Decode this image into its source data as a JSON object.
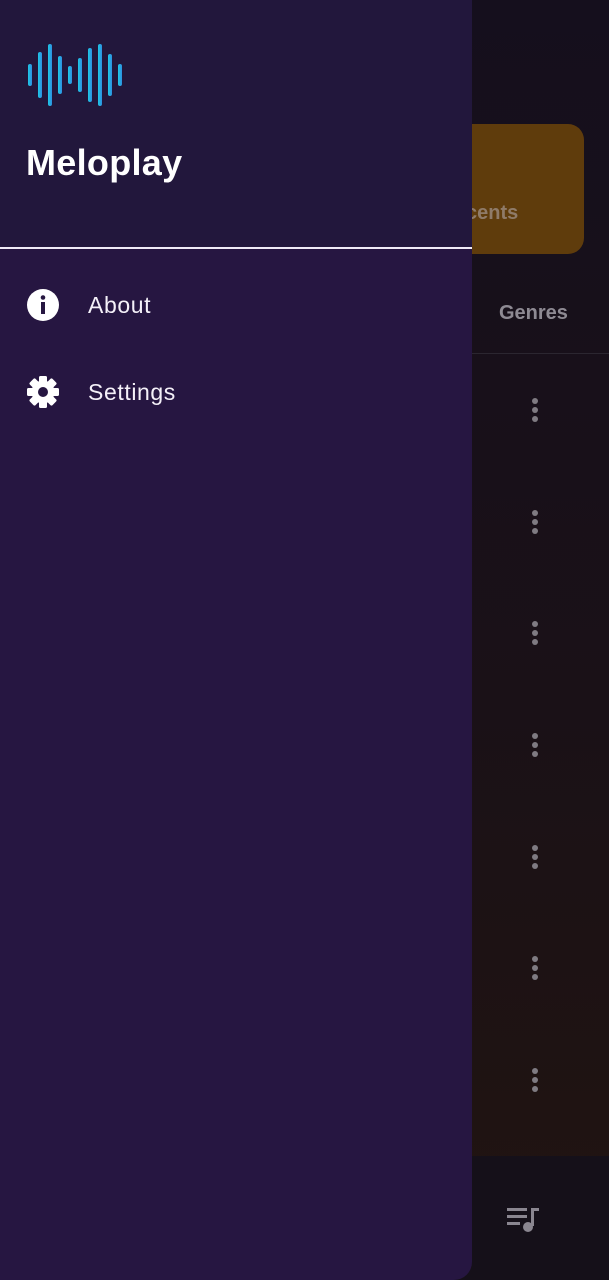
{
  "app": {
    "name": "Meloplay",
    "logo_icon": "soundwave-icon",
    "logo_gradient": [
      "#1ec8e6",
      "#2f8fe0"
    ]
  },
  "drawer": {
    "items": [
      {
        "label": "About",
        "icon": "info-icon"
      },
      {
        "label": "Settings",
        "icon": "gear-icon"
      }
    ]
  },
  "background": {
    "card_partial_text": "cents",
    "tab_partial_label": "Genres",
    "row_menu_icon": "more-vert-icon",
    "bottom_icon": "queue-music-icon",
    "card_color": "#5f3c0c"
  },
  "colors": {
    "drawer_bg": "#261641",
    "drawer_header_bg": "#22173c",
    "text": "#ffffff"
  }
}
